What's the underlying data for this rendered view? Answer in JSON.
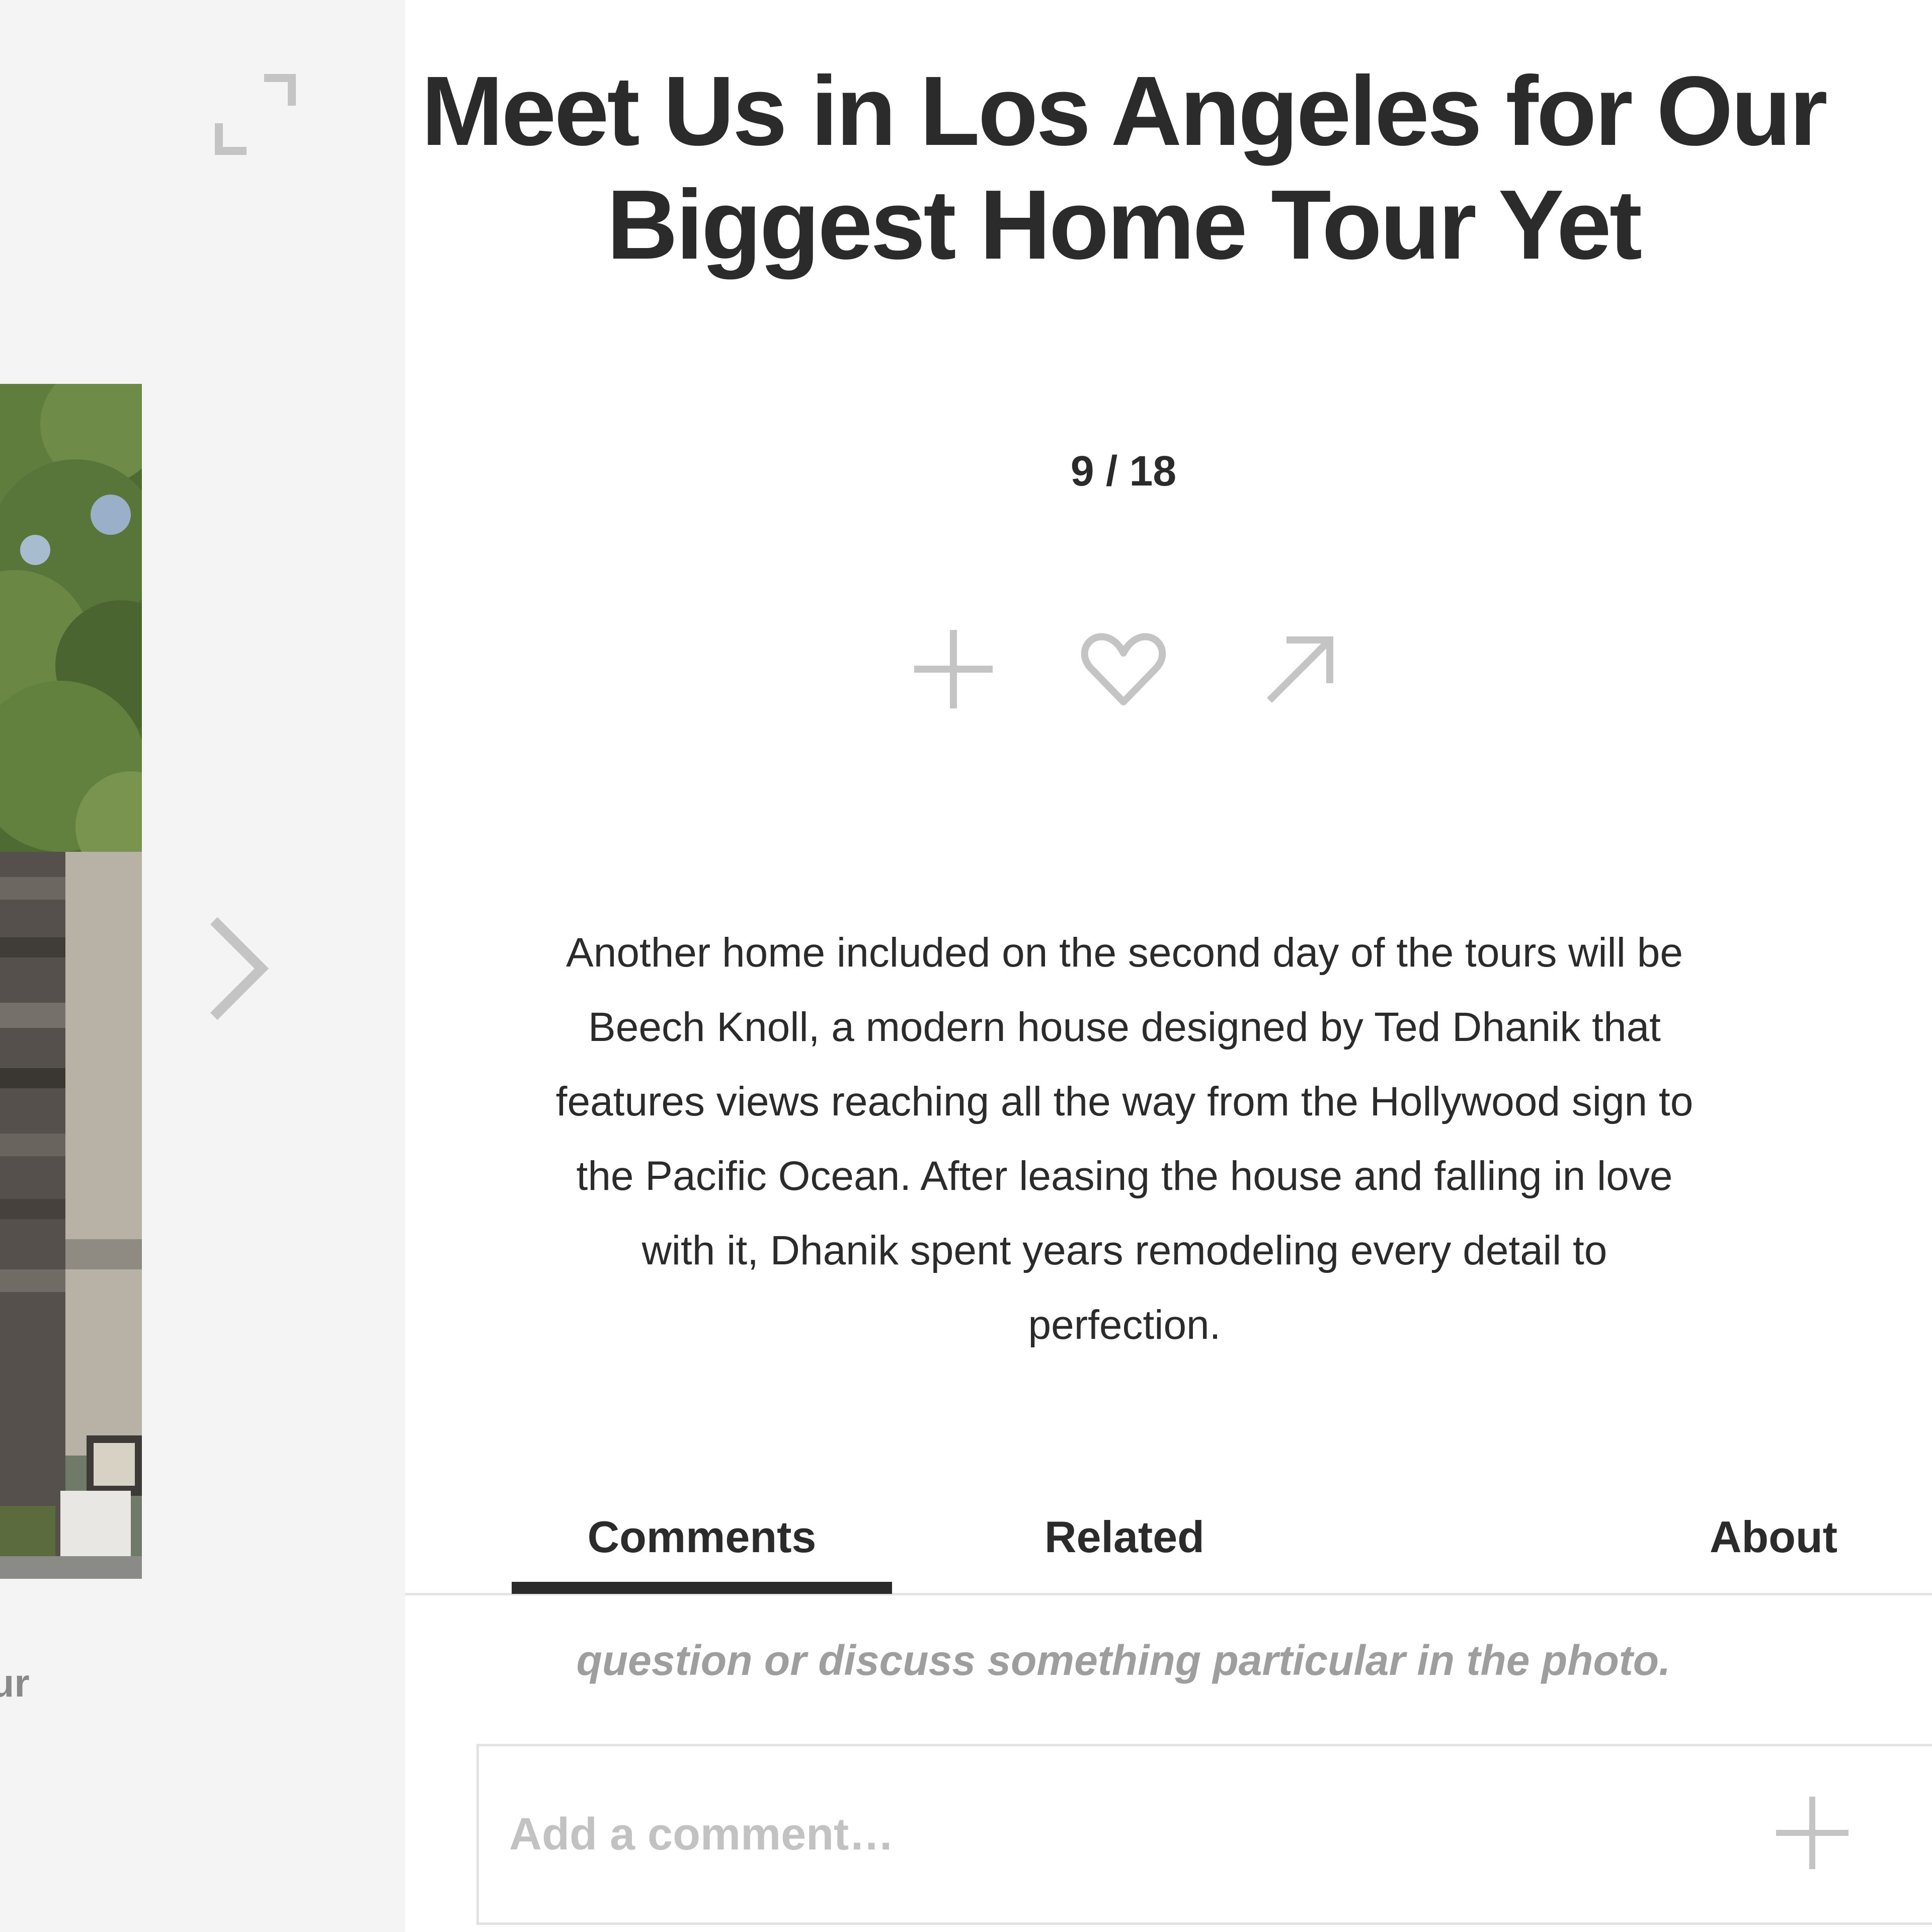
{
  "gallery": {
    "caption_fragment": "Our",
    "icons": {
      "expand": "expand-icon",
      "next": "chevron-right-icon"
    }
  },
  "photo": {
    "subject": "house-exterior-photo"
  },
  "detail": {
    "title": "Meet Us in Los Angeles for Our Biggest Home Tour Yet",
    "counter": "9 / 18",
    "actions": {
      "add_icon": "plus-icon",
      "like_icon": "heart-icon",
      "share_icon": "share-arrow-icon"
    },
    "description": "Another home included on the second day of the tours will be Beech Knoll, a modern house designed by Ted Dhanik that features views reaching all the way from the Hollywood sign to the Pacific Ocean. After leasing the house and falling in love with it, Dhanik spent years remodeling every detail to perfection."
  },
  "tabs": {
    "comments": "Comments",
    "related": "Related",
    "about": "About",
    "active": "Comments"
  },
  "comments": {
    "hint": "question or discuss something particular in the photo.",
    "input_placeholder": "Add a comment…"
  },
  "colors": {
    "text": "#2b2b2b",
    "icon_gray": "#c4c4c4",
    "pane_bg": "#f4f4f4",
    "muted_text": "#9e9e9e"
  }
}
